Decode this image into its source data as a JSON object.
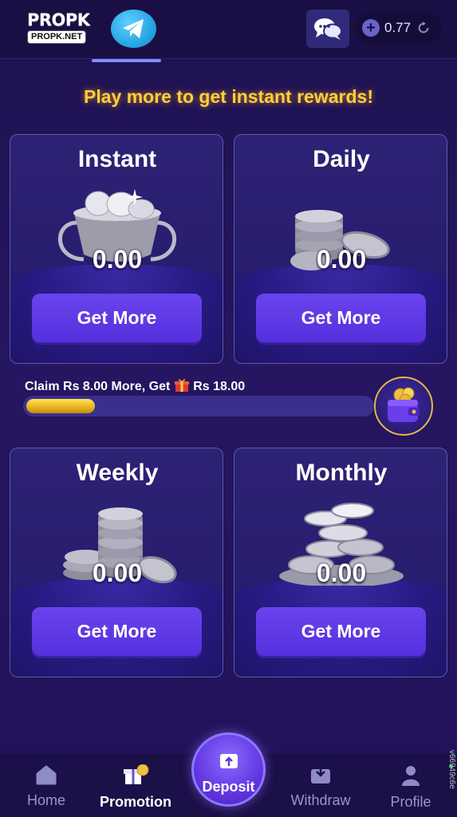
{
  "header": {
    "logo_main": "PROPK",
    "logo_sub": "PROPK.NET",
    "balance": "0.77",
    "icons": {
      "telegram": "telegram-icon",
      "chat": "chat-icon",
      "add": "plus-icon",
      "refresh": "refresh-icon"
    }
  },
  "headline": "Play more to get instant rewards!",
  "cards": [
    {
      "title": "Instant",
      "amount": "0.00",
      "button": "Get More",
      "icon": "trophy-coins-icon"
    },
    {
      "title": "Daily",
      "amount": "0.00",
      "button": "Get More",
      "icon": "coin-stack-icon"
    },
    {
      "title": "Weekly",
      "amount": "0.00",
      "button": "Get More",
      "icon": "coin-stack-icon"
    },
    {
      "title": "Monthly",
      "amount": "0.00",
      "button": "Get More",
      "icon": "coin-pile-icon"
    }
  ],
  "progress": {
    "label_before": "Claim Rs 8.00 More, Get",
    "label_after": "Rs 18.00",
    "fill_fraction": 0.2,
    "icons": {
      "gift": "gift-icon",
      "wallet": "wallet-coins-icon"
    }
  },
  "nav": {
    "home": "Home",
    "promotion": "Promotion",
    "deposit": "Deposit",
    "withdraw": "Withdraw",
    "profile": "Profile",
    "active": "promotion"
  },
  "version": "v66949c6e",
  "colors": {
    "accent": "#5630dd",
    "headline": "#ffcf3a",
    "progress": "#f2c42a"
  }
}
